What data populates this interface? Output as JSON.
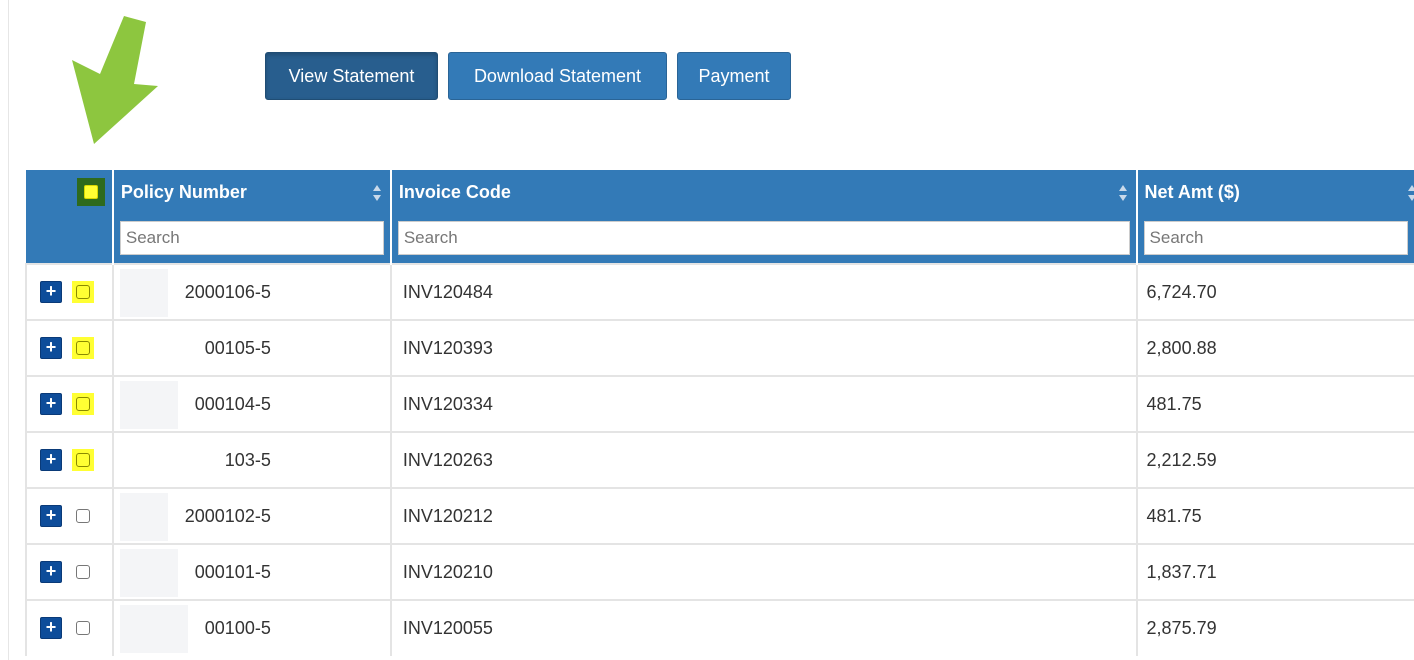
{
  "toolbar": {
    "buttons": [
      {
        "label": "View Statement",
        "active": true
      },
      {
        "label": "Download Statement",
        "active": false
      },
      {
        "label": "Payment",
        "active": false
      }
    ]
  },
  "annotation": {
    "arrow_color": "#8dc63f",
    "highlight_color": "#ffff33"
  },
  "table": {
    "header_color": "#337ab7",
    "columns": [
      {
        "label": "Policy Number",
        "search_placeholder": "Search"
      },
      {
        "label": "Invoice Code",
        "search_placeholder": "Search"
      },
      {
        "label": "Net Amt ($)",
        "search_placeholder": "Search"
      }
    ],
    "select_all": {
      "highlighted": true
    },
    "expand_symbol": "+",
    "rows": [
      {
        "policy": "2000106-5",
        "invoice": "INV120484",
        "net_amt": "6,724.70",
        "highlighted": true
      },
      {
        "policy": "00105-5",
        "invoice": "INV120393",
        "net_amt": "2,800.88",
        "highlighted": true
      },
      {
        "policy": "000104-5",
        "invoice": "INV120334",
        "net_amt": "481.75",
        "highlighted": true
      },
      {
        "policy": "103-5",
        "invoice": "INV120263",
        "net_amt": "2,212.59",
        "highlighted": true
      },
      {
        "policy": "2000102-5",
        "invoice": "INV120212",
        "net_amt": "481.75",
        "highlighted": false
      },
      {
        "policy": "000101-5",
        "invoice": "INV120210",
        "net_amt": "1,837.71",
        "highlighted": false
      },
      {
        "policy": "00100-5",
        "invoice": "INV120055",
        "net_amt": "2,875.79",
        "highlighted": false
      }
    ]
  }
}
